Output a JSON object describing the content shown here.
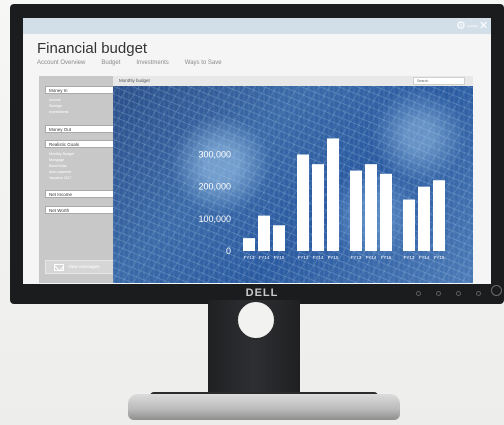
{
  "brand": {
    "logo": "DELL"
  },
  "window": {
    "gear_icon": "gear-icon",
    "minimize_glyph": "—",
    "close_glyph": "✕"
  },
  "app": {
    "title": "Financial budget",
    "tabs": [
      "Account Overview",
      "Budget",
      "Investments",
      "Ways to Save"
    ]
  },
  "sidebar": {
    "money_in": {
      "label": "Money In",
      "items": [
        "Income",
        "Savings",
        "Investments"
      ]
    },
    "money_out": {
      "label": "Money Out"
    },
    "realistic_goals": {
      "label": "Realistic Goals",
      "items": [
        "Monthly Budget",
        "Mortgage",
        "Bond Build",
        "Auto payment",
        "Vacation 2017"
      ]
    },
    "net_income": {
      "label": "Net Income"
    },
    "net_worth": {
      "label": "Net Worth"
    },
    "view_messages": "View messages"
  },
  "main": {
    "header_label": "Monthly budget",
    "search_placeholder": "Search"
  },
  "chart_data": {
    "type": "bar",
    "title": "",
    "xlabel": "",
    "ylabel": "",
    "ylim": [
      0,
      370000
    ],
    "yticks": [
      0,
      100000,
      200000,
      300000
    ],
    "ytick_labels": [
      "0",
      "100,000",
      "200,000",
      "300,000"
    ],
    "groups": [
      {
        "categories": [
          "FY13",
          "FY14",
          "FY15"
        ],
        "values": [
          40000,
          110000,
          80000
        ]
      },
      {
        "categories": [
          "FY13",
          "FY14",
          "FY15"
        ],
        "values": [
          300000,
          270000,
          350000
        ]
      },
      {
        "categories": [
          "FY13",
          "FY14",
          "FY15"
        ],
        "values": [
          250000,
          270000,
          240000
        ]
      },
      {
        "categories": [
          "FY13",
          "FY14",
          "FY15"
        ],
        "values": [
          160000,
          200000,
          220000
        ]
      }
    ],
    "bar_color": "#ffffff",
    "grid": false
  }
}
